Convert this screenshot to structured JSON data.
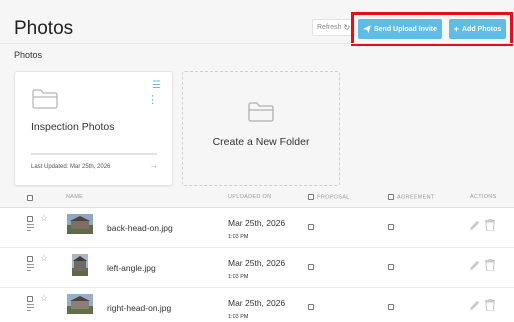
{
  "header": {
    "title": "Photos",
    "refresh_label": "Refresh",
    "send_invite_label": "Send Upload Invite",
    "add_photos_label": "Add Photos"
  },
  "section_label": "Photos",
  "folders": [
    {
      "name": "Inspection Photos",
      "last_updated": "Last Updated: Mar 25th, 2026"
    }
  ],
  "new_folder_label": "Create a New Folder",
  "table": {
    "headers": {
      "name": "NAME",
      "uploaded_on": "UPLOADED ON",
      "proposal": "PROPOSAL",
      "agreement": "AGREEMENT",
      "actions": "ACTIONS"
    },
    "rows": [
      {
        "file_name": "back-head-on.jpg",
        "date": "Mar 25th, 2026",
        "time": "1:03 PM"
      },
      {
        "file_name": "left-angle.jpg",
        "date": "Mar 25th, 2026",
        "time": "1:03 PM"
      },
      {
        "file_name": "right-head-on.jpg",
        "date": "Mar 25th, 2026",
        "time": "1:03 PM"
      }
    ]
  },
  "colors": {
    "accent": "#5dbde6",
    "highlight": "#e3101a"
  },
  "icons": [
    "refresh-icon",
    "paper-plane-icon",
    "plus-icon",
    "folder-icon",
    "menu-icon",
    "more-dots-icon",
    "arrow-right-icon",
    "star-icon",
    "drag-lines-icon",
    "edit-pencil-icon",
    "trash-icon"
  ]
}
